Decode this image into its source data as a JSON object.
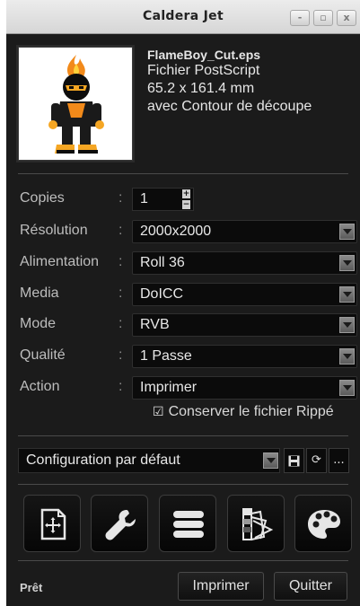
{
  "window": {
    "title": "Caldera Jet",
    "controls": {
      "minimize": "-",
      "maximize": "▫",
      "close": "x"
    }
  },
  "file": {
    "name": "FlameBoy_Cut.eps",
    "type": "Fichier PostScript",
    "size": "65.2 x 161.4 mm",
    "contour": "avec Contour de découpe"
  },
  "settings": {
    "copies": {
      "label": "Copies",
      "value": "1"
    },
    "resolution": {
      "label": "Résolution",
      "value": "2000x2000"
    },
    "feed": {
      "label": "Alimentation",
      "value": "Roll 36"
    },
    "media": {
      "label": "Media",
      "value": "DoICC"
    },
    "mode": {
      "label": "Mode",
      "value": "RVB"
    },
    "quality": {
      "label": "Qualité",
      "value": "1 Passe"
    },
    "action": {
      "label": "Action",
      "value": "Imprimer"
    },
    "separator": ":"
  },
  "keep_ripped": {
    "label": "Conserver le fichier Rippé",
    "checked": true
  },
  "config": {
    "value": "Configuration par défaut",
    "more": "..."
  },
  "toolbar": {
    "icons": [
      "add-page-icon",
      "wrench-icon",
      "queue-list-icon",
      "color-swatch-icon",
      "palette-icon"
    ]
  },
  "footer": {
    "status": "Prêt",
    "print_label": "Imprimer",
    "quit_label": "Quitter"
  },
  "colors": {
    "background": "#1b1b1b",
    "field": "#0b0b0b",
    "text": "#e8e8e8",
    "label": "#bdbdbd",
    "flame": "#f28a1a"
  }
}
